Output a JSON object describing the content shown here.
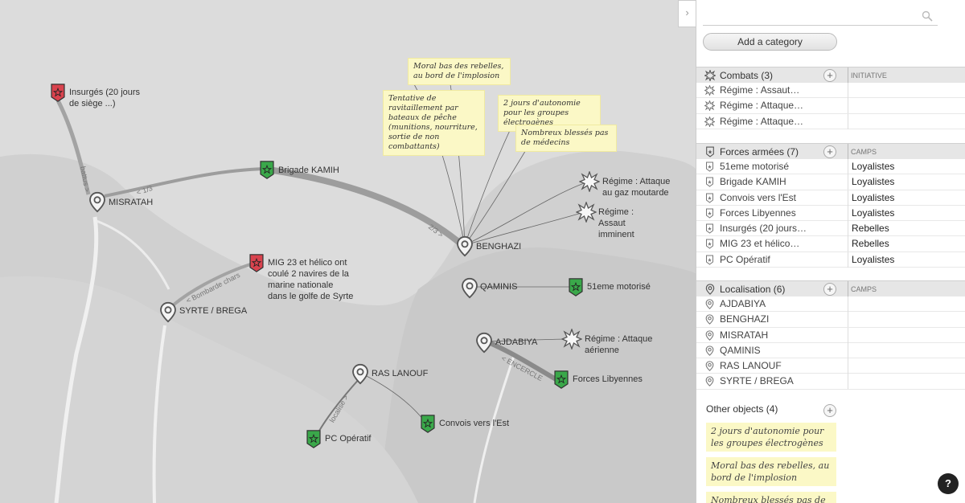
{
  "places": [
    {
      "key": "misratah",
      "label": "MISRATAH"
    },
    {
      "key": "benghazi",
      "label": "BENGHAZI"
    },
    {
      "key": "qaminis",
      "label": "QAMINIS"
    },
    {
      "key": "syrte",
      "label": "SYRTE / BREGA"
    },
    {
      "key": "ajdabiya",
      "label": "AJDABIYA"
    },
    {
      "key": "raslanouf",
      "label": "RAS LANOUF"
    }
  ],
  "forces": [
    {
      "key": "insurges",
      "label": "Insurgés (20 jours de siège ...)",
      "color": "#d9434e"
    },
    {
      "key": "kamih",
      "label": "Brigade KAMIH",
      "color": "#3aa84a"
    },
    {
      "key": "mig",
      "label": "MIG 23 et hélico ont coulé 2 navires de la marine nationale dans le golfe de Syrte",
      "color": "#d9434e"
    },
    {
      "key": "motorise",
      "label": "51eme motorisé",
      "color": "#3aa84a"
    },
    {
      "key": "libyennes",
      "label": "Forces Libyennes",
      "color": "#3aa84a"
    },
    {
      "key": "convois",
      "label": "Convois vers l'Est",
      "color": "#3aa84a"
    },
    {
      "key": "pcop",
      "label": "PC Opératif",
      "color": "#3aa84a"
    }
  ],
  "combats": [
    {
      "key": "gaz",
      "label": "Régime : Attaque au gaz moutarde"
    },
    {
      "key": "assaut",
      "label": "Régime : Assaut imminent"
    },
    {
      "key": "aerienne",
      "label": "Régime : Attaque aérienne"
    }
  ],
  "edge_labels": {
    "battus": "battus >",
    "one_third": "< 1/3",
    "two_thirds": "2/3 >",
    "bombarde": "< Bombarde chars",
    "encercle": "< ENCERCLE",
    "localise": "localisé >"
  },
  "notes": [
    {
      "key": "moral",
      "text": "Moral bas des rebelles, au bord de l'implosion"
    },
    {
      "key": "tentative",
      "text": "Tentative de ravitaillement par bateaux de pêche (munitions, nourriture, sortie de non combattants)"
    },
    {
      "key": "autonomie",
      "text": "2 jours d'autonomie pour les groupes électrogènes"
    },
    {
      "key": "blesses",
      "text": "Nombreux blessés pas de médecins"
    }
  ],
  "sidebar": {
    "collapse_icon": "chevron-right-icon",
    "search_placeholder": "",
    "add_category": "Add a category",
    "combats": {
      "title": "Combats (3)",
      "column": "INITIATIVE",
      "rows": [
        {
          "name": "Régime : Assaut…",
          "value": ""
        },
        {
          "name": "Régime : Attaque…",
          "value": ""
        },
        {
          "name": "Régime : Attaque…",
          "value": ""
        }
      ]
    },
    "forces": {
      "title": "Forces armées (7)",
      "column": "CAMPS",
      "rows": [
        {
          "name": "51eme motorisé",
          "value": "Loyalistes"
        },
        {
          "name": "Brigade KAMIH",
          "value": "Loyalistes"
        },
        {
          "name": "Convois vers l'Est",
          "value": "Loyalistes"
        },
        {
          "name": "Forces Libyennes",
          "value": "Loyalistes"
        },
        {
          "name": "Insurgés (20 jours…",
          "value": "Rebelles"
        },
        {
          "name": "MIG 23 et hélico…",
          "value": "Rebelles"
        },
        {
          "name": "PC Opératif",
          "value": "Loyalistes"
        }
      ]
    },
    "localisation": {
      "title": "Localisation (6)",
      "column": "CAMPS",
      "rows": [
        {
          "name": "AJDABIYA",
          "value": ""
        },
        {
          "name": "BENGHAZI",
          "value": ""
        },
        {
          "name": "MISRATAH",
          "value": ""
        },
        {
          "name": "QAMINIS",
          "value": ""
        },
        {
          "name": "RAS LANOUF",
          "value": ""
        },
        {
          "name": "SYRTE / BREGA",
          "value": ""
        }
      ]
    },
    "other": {
      "title": "Other objects (4)",
      "notes": [
        "2 jours d'autonomie pour les groupes électrogènes",
        "Moral bas des rebelles, au bord de l'implosion",
        "Nombreux blessés pas de médecins"
      ]
    },
    "help": "?"
  }
}
